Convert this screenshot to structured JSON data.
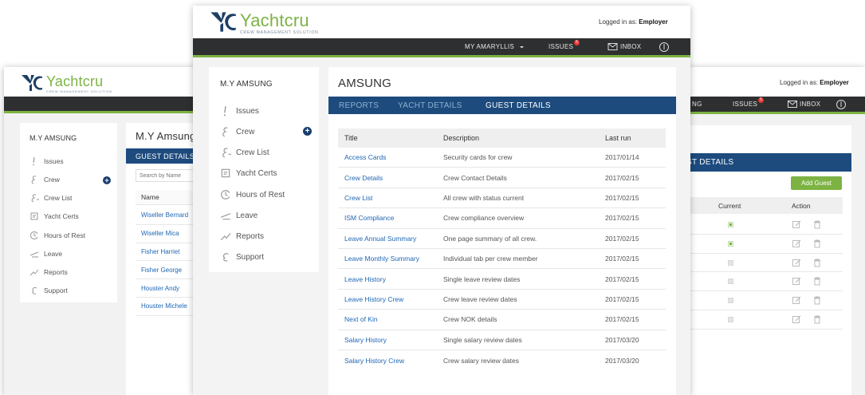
{
  "brand": {
    "name": "Yachtcru",
    "tagline": "CREW MANAGEMENT SOLUTION"
  },
  "colors": {
    "brand_green": "#7cb342",
    "navy": "#1d4b7e",
    "navbar": "#2e2f30",
    "link_blue": "#1f67b4",
    "badge_red": "#e53935"
  },
  "header": {
    "logged_in_label": "Logged in as:",
    "role": "Employer"
  },
  "nav": {
    "vessel": "MY AMARYLLIS",
    "issues": "ISSUES",
    "issues_badge": "5",
    "inbox": "INBOX",
    "issues_right": "ISSUES",
    "vessel_fragment": "NG"
  },
  "sidebar": {
    "title": "M.Y AMSUNG",
    "items": [
      {
        "label": "Issues",
        "icon": "exclamation-icon"
      },
      {
        "label": "Crew",
        "icon": "crew-icon"
      },
      {
        "label": "Crew List",
        "icon": "crew-list-icon"
      },
      {
        "label": "Yacht Certs",
        "icon": "certificate-icon"
      },
      {
        "label": "Hours of Rest",
        "icon": "clock-icon"
      },
      {
        "label": "Leave",
        "icon": "airplane-icon"
      },
      {
        "label": "Reports",
        "icon": "chart-trend-icon"
      },
      {
        "label": "Support",
        "icon": "support-icon"
      }
    ],
    "add_symbol": "+"
  },
  "main": {
    "title": "AMSUNG",
    "tabs": [
      {
        "label": "REPORTS"
      },
      {
        "label": "YACHT DETAILS"
      },
      {
        "label": "GUEST DETAILS"
      }
    ],
    "active_tab": "GUEST DETAILS",
    "reports_table": {
      "columns": [
        "Title",
        "Description",
        "Last run"
      ],
      "rows": [
        [
          "Access Cards",
          "Security cards for crew",
          "2017/01/14"
        ],
        [
          "Crew Details",
          "Crew Contact Details",
          "2017/02/15"
        ],
        [
          "Crew List",
          "All crew with status current",
          "2017/02/15"
        ],
        [
          "ISM Compliance",
          "Crew compliance overview",
          "2017/02/15"
        ],
        [
          "Leave Annual Summary",
          "One page summary of all crew.",
          "2017/02/15"
        ],
        [
          "Leave Monthly Summary",
          "Individual tab per crew member",
          "2017/02/15"
        ],
        [
          "Leave History",
          "Single leave review dates",
          "2017/02/15"
        ],
        [
          "Leave History Crew",
          "Crew leave review dates",
          "2017/02/15"
        ],
        [
          "Next of Kin",
          "Crew NOK details",
          "2017/02/15"
        ],
        [
          "Salary History",
          "Single salary review dates",
          "2017/03/20"
        ],
        [
          "Salary History Crew",
          "Crew salary review dates",
          "2017/03/20"
        ]
      ]
    }
  },
  "left_window": {
    "title": "M.Y Amsung",
    "tab": "GUEST DETAILS",
    "search_placeholder": "Search by Name",
    "column": "Name",
    "names": [
      "Wiseller Bernard",
      "Wiseller Mica",
      "Fisher Harriet",
      "Fisher George",
      "Houster Andy",
      "Houster Michele"
    ]
  },
  "right_window": {
    "tab_fragment": "ST DETAILS",
    "add_button": "Add Guest",
    "columns": [
      "Current",
      "Action"
    ],
    "current_flags": [
      true,
      true,
      false,
      false,
      false,
      false
    ]
  }
}
